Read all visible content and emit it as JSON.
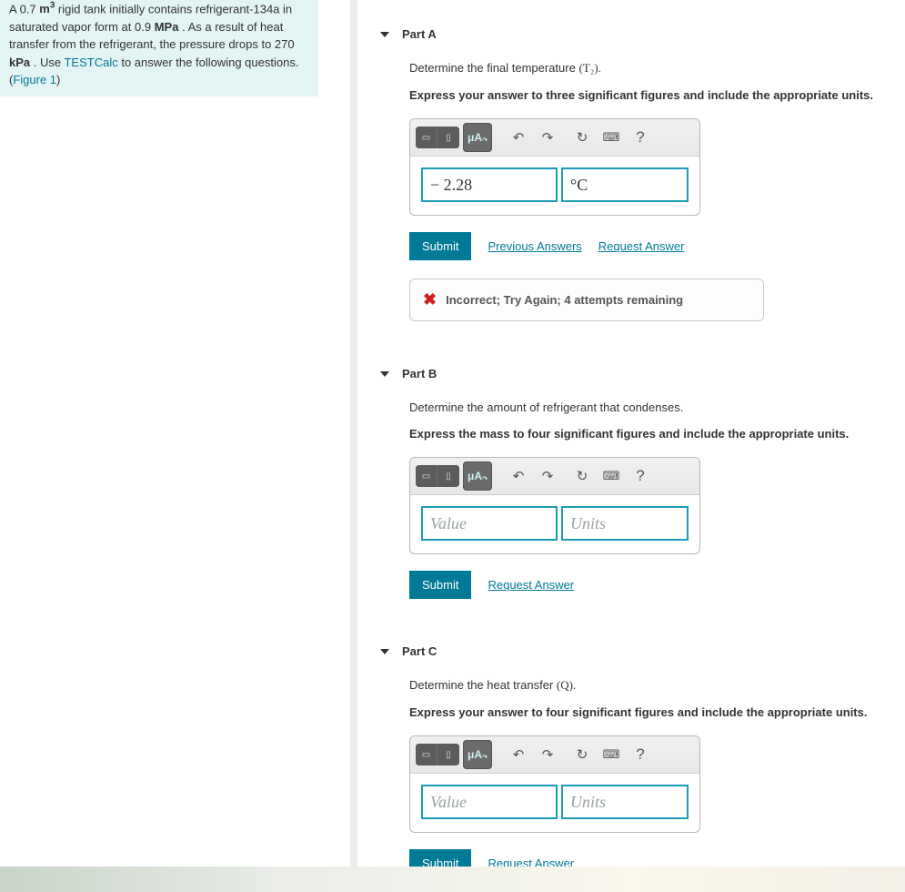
{
  "prompt": {
    "text_before_link1": "A 0.7 m³ rigid tank initially contains refrigerant-134a in saturated vapor form at 0.9 MPa . As a result of heat transfer from the refrigerant, the pressure drops to 270 kPa . Use ",
    "link1": "TESTCalc",
    "text_mid": " to answer the following questions. (",
    "link2": "Figure 1",
    "text_after": ")",
    "volume": "0.7",
    "vol_unit": "m",
    "vol_sup": "3",
    "p1": "0.9",
    "p1_unit": "MPa",
    "p2": "270",
    "p2_unit": "kPa"
  },
  "parts": {
    "a": {
      "title": "Part A",
      "question_pre": "Determine the final temperature ",
      "question_sym": "(T₂).",
      "hint": "Express your answer to three significant figures and include the appropriate units.",
      "value": "− 2.28",
      "units": "°C",
      "value_placeholder": "Value",
      "units_placeholder": "Units",
      "value_filled": true,
      "units_filled": true,
      "prev_answers": "Previous Answers",
      "feedback": "Incorrect; Try Again; 4 attempts remaining"
    },
    "b": {
      "title": "Part B",
      "question": "Determine the amount of refrigerant that condenses.",
      "hint": "Express the mass to four significant figures and include the appropriate units.",
      "value_placeholder": "Value",
      "units_placeholder": "Units"
    },
    "c": {
      "title": "Part C",
      "question_pre": "Determine the heat transfer ",
      "question_sym": "(Q).",
      "hint": "Express your answer to four significant figures and include the appropriate units.",
      "value_placeholder": "Value",
      "units_placeholder": "Units"
    }
  },
  "common": {
    "submit": "Submit",
    "request": "Request Answer",
    "toolbar": {
      "format": "μΑ",
      "undo": "↶",
      "redo": "↷",
      "reset": "↻",
      "keyboard": "⌨",
      "help": "?"
    }
  }
}
